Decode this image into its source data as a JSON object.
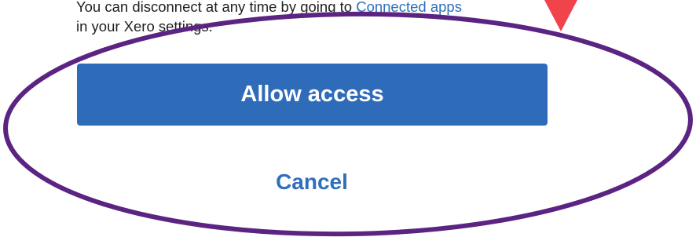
{
  "disclaimer": {
    "text_before_link": "You can disconnect at any time by going to ",
    "link_text": "Connected apps",
    "text_after_link": "in your Xero settings."
  },
  "actions": {
    "allow_label": "Allow access",
    "cancel_label": "Cancel"
  },
  "colors": {
    "primary_button": "#2e6bb8",
    "link": "#2f6fbd",
    "annotation_ellipse": "#5b2483",
    "annotation_arrow": "#f0434b"
  },
  "annotation": {
    "ellipse_icon": "highlight-ellipse",
    "arrow_icon": "red-arrow-pointer"
  }
}
